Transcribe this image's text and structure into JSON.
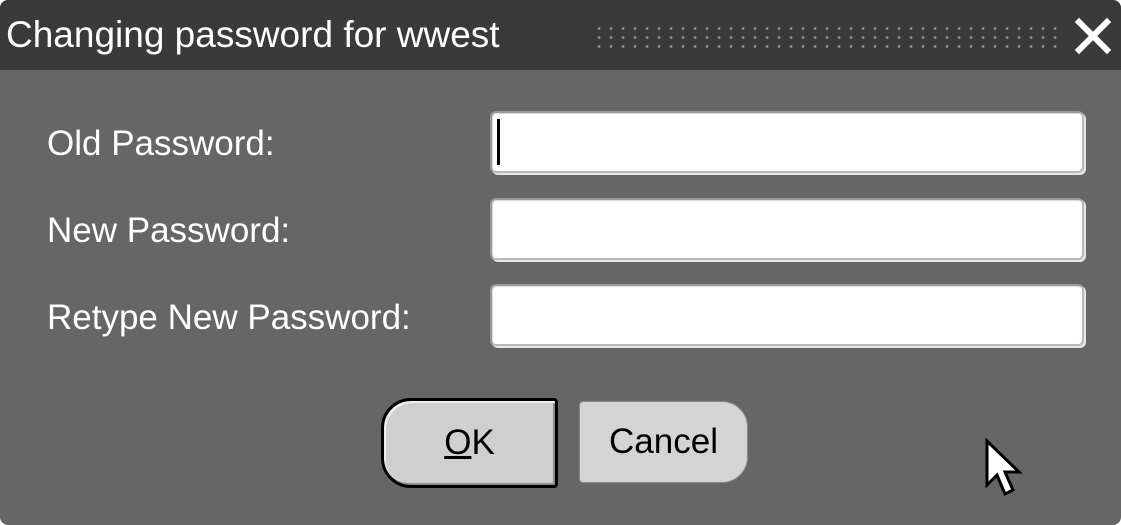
{
  "dialog": {
    "title": "Changing password for wwest",
    "close_icon": "close-icon",
    "colors": {
      "titlebar": "#3a3a3a",
      "body": "#666666",
      "text": "#ffffff"
    }
  },
  "form": {
    "old_password": {
      "label": "Old Password:",
      "value": ""
    },
    "new_password": {
      "label": "New Password:",
      "value": ""
    },
    "retype_password": {
      "label": "Retype New Password:",
      "value": ""
    }
  },
  "buttons": {
    "ok": {
      "mnemonic": "O",
      "rest": "K"
    },
    "cancel": {
      "label": "Cancel"
    }
  },
  "pointer": {
    "icon": "mouse-cursor-icon"
  }
}
